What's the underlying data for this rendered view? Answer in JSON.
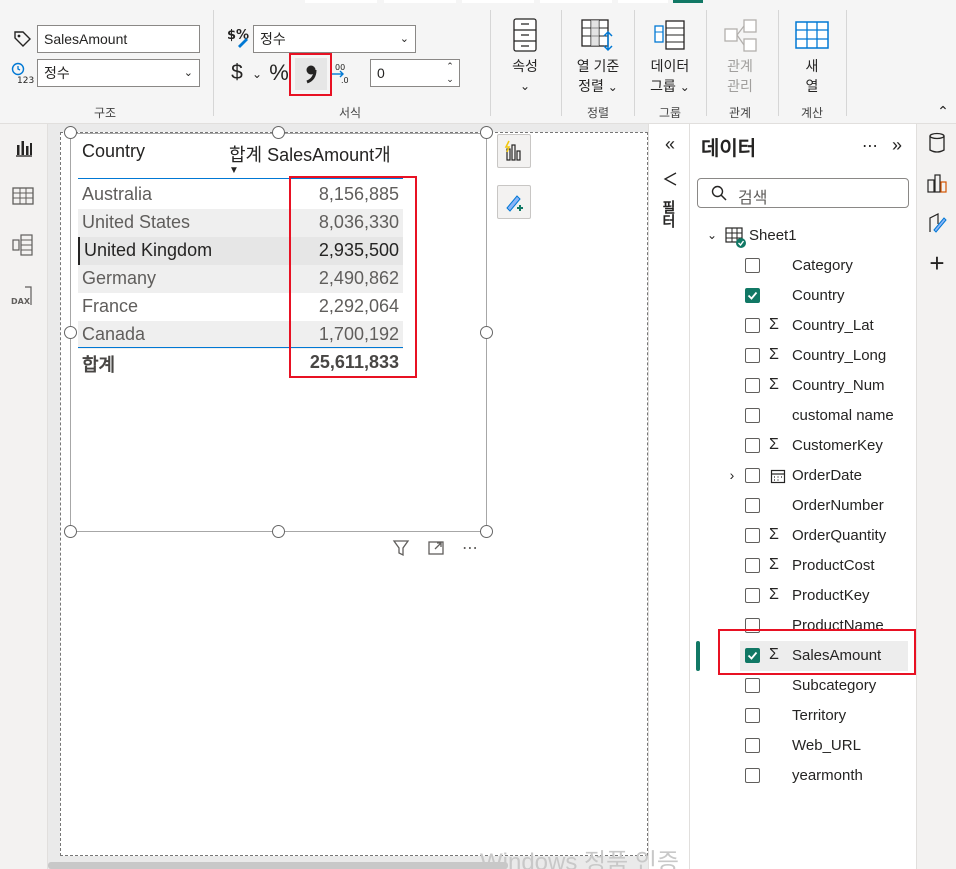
{
  "ribbon": {
    "structure": {
      "name_value": "SalesAmount",
      "datatype_value": "정수",
      "group_label": "구조"
    },
    "format": {
      "format_value": "정수",
      "currency_symbol": "$",
      "percent_symbol": "%",
      "decimal_value": "0",
      "group_label": "서식"
    },
    "properties": {
      "label": "속성"
    },
    "sort": {
      "label_line1": "열 기준",
      "label_line2": "정렬",
      "group_label": "정렬"
    },
    "groups": {
      "label_line1": "데이터",
      "label_line2": "그룹",
      "group_label": "그룹"
    },
    "relationships": {
      "label_line1": "관계",
      "label_line2": "관리",
      "group_label": "관계"
    },
    "calculations": {
      "label_line1": "새",
      "label_line2": "열",
      "group_label": "계산"
    }
  },
  "visual": {
    "header_country": "Country",
    "header_sum": "합계 SalesAmount개",
    "rows": [
      {
        "country": "Australia",
        "amount": "8,156,885"
      },
      {
        "country": "United States",
        "amount": "8,036,330"
      },
      {
        "country": "United Kingdom",
        "amount": "2,935,500"
      },
      {
        "country": "Germany",
        "amount": "2,490,862"
      },
      {
        "country": "France",
        "amount": "2,292,064"
      },
      {
        "country": "Canada",
        "amount": "1,700,192"
      }
    ],
    "total_label": "합계",
    "total_value": "25,611,833"
  },
  "filters": {
    "label": "필터"
  },
  "data_pane": {
    "title": "데이터",
    "search_placeholder": "검색",
    "table_name": "Sheet1",
    "fields": [
      {
        "name": "Category",
        "checked": false,
        "sigma": false
      },
      {
        "name": "Country",
        "checked": true,
        "sigma": false
      },
      {
        "name": "Country_Lat",
        "checked": false,
        "sigma": true
      },
      {
        "name": "Country_Long",
        "checked": false,
        "sigma": true
      },
      {
        "name": "Country_Num",
        "checked": false,
        "sigma": true
      },
      {
        "name": "customal name",
        "checked": false,
        "sigma": false
      },
      {
        "name": "CustomerKey",
        "checked": false,
        "sigma": true
      },
      {
        "name": "OrderDate",
        "checked": false,
        "sigma": false
      },
      {
        "name": "OrderNumber",
        "checked": false,
        "sigma": false
      },
      {
        "name": "OrderQuantity",
        "checked": false,
        "sigma": true
      },
      {
        "name": "ProductCost",
        "checked": false,
        "sigma": true
      },
      {
        "name": "ProductKey",
        "checked": false,
        "sigma": true
      },
      {
        "name": "ProductName",
        "checked": false,
        "sigma": false
      },
      {
        "name": "SalesAmount",
        "checked": true,
        "sigma": true
      },
      {
        "name": "Subcategory",
        "checked": false,
        "sigma": false
      },
      {
        "name": "Territory",
        "checked": false,
        "sigma": false
      },
      {
        "name": "Web_URL",
        "checked": false,
        "sigma": false
      },
      {
        "name": "yearmonth",
        "checked": false,
        "sigma": false
      }
    ]
  },
  "watermark": "Windows 정품 인증",
  "colors": {
    "accent": "#117865",
    "highlight": "#e81123"
  }
}
